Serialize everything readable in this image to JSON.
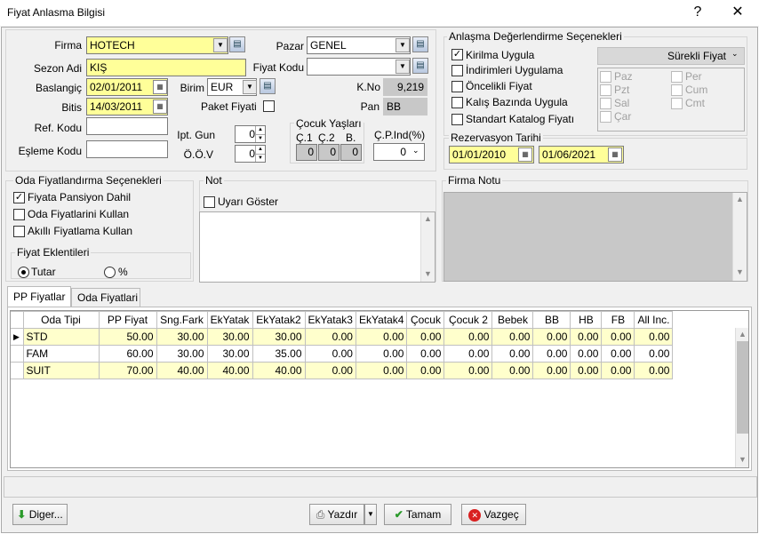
{
  "window": {
    "title": "Fiyat Anlasma Bilgisi",
    "help": "?",
    "close": "✕"
  },
  "form": {
    "firma_label": "Firma",
    "firma_value": "HOTECH",
    "sezon_label": "Sezon Adi",
    "sezon_value": "KIŞ",
    "baslangic_label": "Baslangiç",
    "baslangic_value": "02/01/2011",
    "bitis_label": "Bitis",
    "bitis_value": "14/03/2011",
    "refkodu_label": "Ref. Kodu",
    "refkodu_value": "",
    "eslemekodu_label": "Eşleme Kodu",
    "eslemekodu_value": "",
    "pazar_label": "Pazar",
    "pazar_value": "GENEL",
    "fiyatkodu_label": "Fiyat Kodu",
    "fiyatkodu_value": "",
    "birim_label": "Birim",
    "birim_value": "EUR",
    "kno_label": "K.No",
    "kno_value": "9,219",
    "paket_label": "Paket Fiyati",
    "pan_label": "Pan",
    "pan_value": "BB",
    "iptgun_label": "Ipt. Gun",
    "iptgun_value": "0",
    "oov_label": "Ö.Ö.V",
    "oov_value": "0",
    "cocuk_title": "Çocuk Yaşları",
    "cocuk_headers": [
      "Ç.1",
      "Ç.2",
      "B."
    ],
    "cocuk_values": [
      "0",
      "0",
      "0"
    ],
    "cpind_label": "Ç.P.Ind(%)",
    "cpind_value": "0"
  },
  "degerlendirme": {
    "title": "Anlaşma Değerlendirme Seçenekleri",
    "options": [
      {
        "label": "Kirilma Uygula",
        "checked": true
      },
      {
        "label": "İndirimleri Uygulama",
        "checked": false
      },
      {
        "label": "Öncelikli Fiyat",
        "checked": false
      },
      {
        "label": "Kalış Bazında Uygula",
        "checked": false
      },
      {
        "label": "Standart Katalog Fiyatı",
        "checked": false
      }
    ],
    "fiyat_tipi": "Sürekli Fiyat",
    "days": [
      "Paz",
      "Per",
      "Pzt",
      "Cum",
      "Sal",
      "Cmt",
      "Çar"
    ]
  },
  "rezervasyon": {
    "title": "Rezervasyon Tarihi",
    "start": "01/01/2010",
    "end": "01/06/2021"
  },
  "oda": {
    "title": "Oda Fiyatlandırma Seçenekleri",
    "options": [
      {
        "label": "Fiyata Pansiyon Dahil",
        "checked": true
      },
      {
        "label": "Oda Fiyatlarini Kullan",
        "checked": false
      },
      {
        "label": "Akıllı Fiyatlama Kullan",
        "checked": false
      }
    ],
    "eklenti_title": "Fiyat Eklentileri",
    "tutar_label": "Tutar",
    "yuzde_label": "%"
  },
  "not": {
    "title": "Not",
    "uyari_label": "Uyarı Göster",
    "text": ""
  },
  "firma_notu": {
    "title": "Firma Notu"
  },
  "tabs": [
    {
      "label": "PP Fiyatlar"
    },
    {
      "label": "Oda Fiyatlari"
    }
  ],
  "grid": {
    "headers": [
      "Oda Tipi",
      "PP Fiyat",
      "Sng.Fark",
      "EkYatak",
      "EkYatak2",
      "EkYatak3",
      "EkYatak4",
      "Çocuk",
      "Çocuk 2",
      "Bebek",
      "BB",
      "HB",
      "FB",
      "All Inc."
    ],
    "rows": [
      [
        "STD",
        "50.00",
        "30.00",
        "30.00",
        "30.00",
        "0.00",
        "0.00",
        "0.00",
        "0.00",
        "0.00",
        "0.00",
        "0.00",
        "0.00",
        "0.00"
      ],
      [
        "FAM",
        "60.00",
        "30.00",
        "30.00",
        "35.00",
        "0.00",
        "0.00",
        "0.00",
        "0.00",
        "0.00",
        "0.00",
        "0.00",
        "0.00",
        "0.00"
      ],
      [
        "SUIT",
        "70.00",
        "40.00",
        "40.00",
        "40.00",
        "0.00",
        "0.00",
        "0.00",
        "0.00",
        "0.00",
        "0.00",
        "0.00",
        "0.00",
        "0.00"
      ]
    ]
  },
  "buttons": {
    "diger": "Diger...",
    "yazdir": "Yazdır",
    "tamam": "Tamam",
    "vazgec": "Vazgeç"
  },
  "colors": {
    "highlight": "#ffff99",
    "grid_row": "#ffffcc",
    "disabled": "#c8c8c8"
  }
}
